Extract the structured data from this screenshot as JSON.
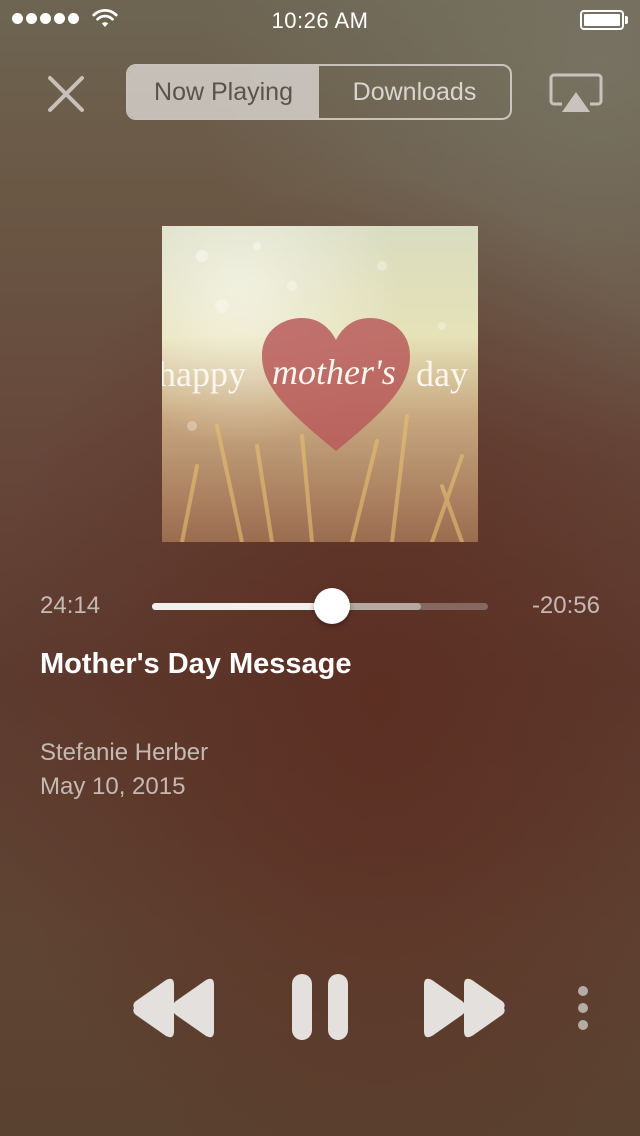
{
  "status_bar": {
    "time": "10:26 AM",
    "signal_bars": 5
  },
  "nav": {
    "tabs": [
      {
        "label": "Now Playing",
        "active": true
      },
      {
        "label": "Downloads",
        "active": false
      }
    ]
  },
  "artwork": {
    "text_left": "happy",
    "text_center": "mother's",
    "text_right": "day"
  },
  "player": {
    "elapsed": "24:14",
    "remaining": "-20:56",
    "progress_fraction": 0.536,
    "buffered_fraction": 0.8,
    "title": "Mother's Day Message",
    "author": "Stefanie Herber",
    "date": "May 10, 2015"
  },
  "colors": {
    "accent_light": "#e8e4e1",
    "heart": "#b85a5c",
    "background_dark": "#5d3a2e"
  }
}
